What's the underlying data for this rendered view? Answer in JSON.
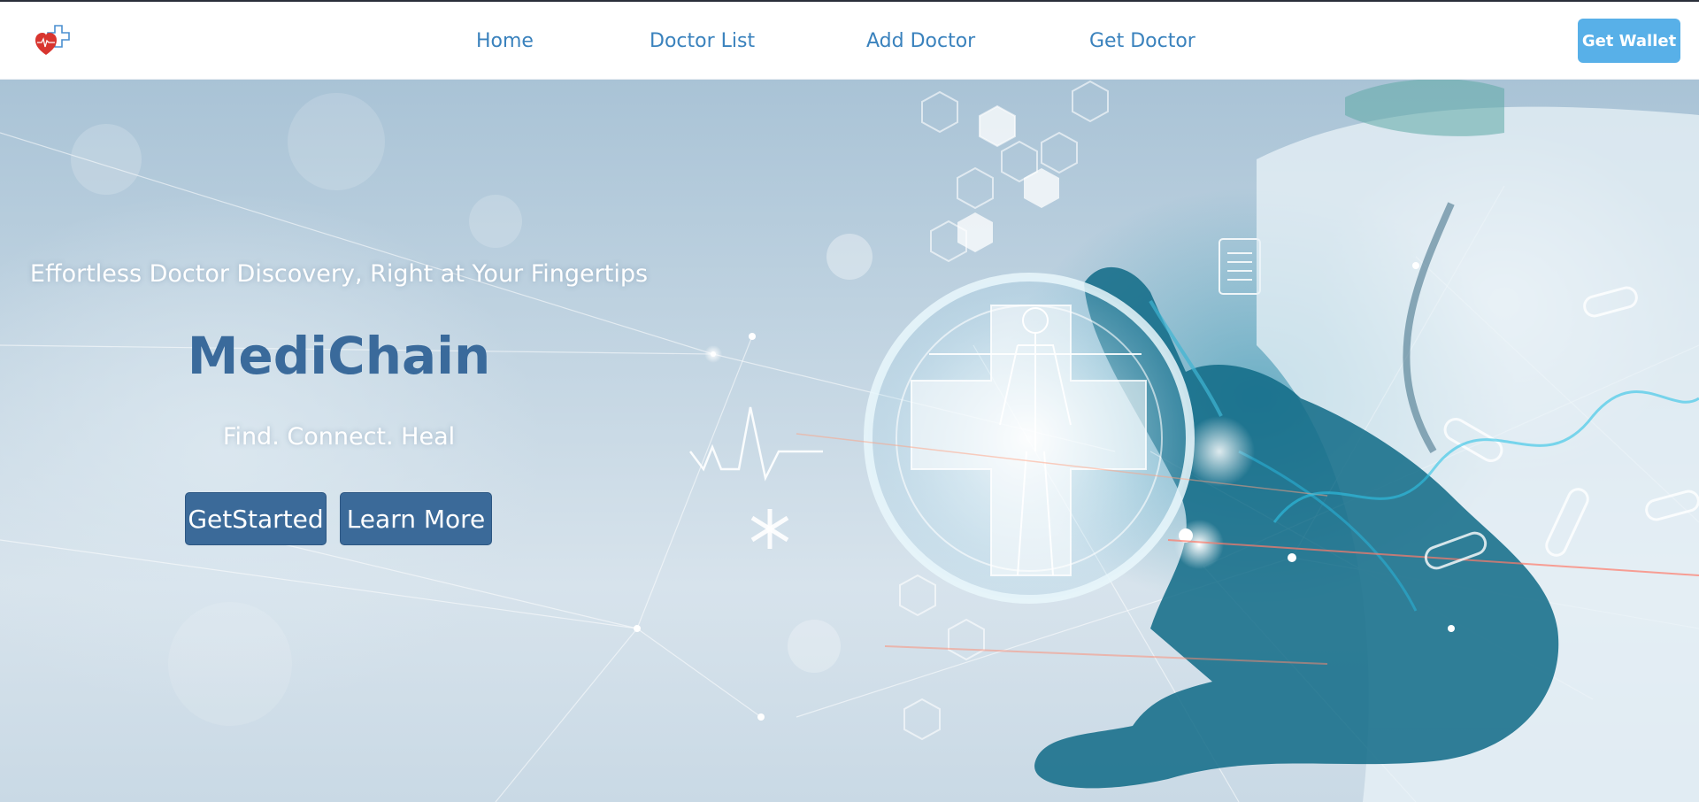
{
  "navbar": {
    "logo_icon": "heart-medical-cross-logo",
    "links": [
      {
        "label": "Home"
      },
      {
        "label": "Doctor List"
      },
      {
        "label": "Add Doctor"
      },
      {
        "label": "Get Doctor"
      }
    ],
    "wallet_button": "Get Wallet"
  },
  "hero": {
    "tagline": "Effortless Doctor Discovery, Right at Your Fingertips",
    "brand": "MediChain",
    "subtagline": "Find. Connect. Heal",
    "primary_button": "GetStarted",
    "secondary_button": "Learn More"
  },
  "colors": {
    "nav_link": "#3a82bd",
    "wallet_button_bg": "#58b0e8",
    "brand_text": "#3a6a9b",
    "hero_button_bg": "#3b6a99"
  }
}
